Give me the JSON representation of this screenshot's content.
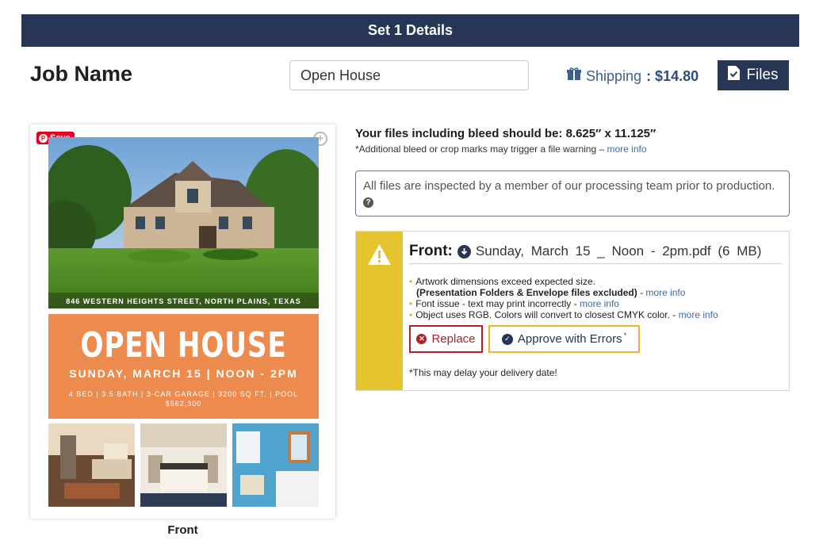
{
  "header": {
    "title": "Set 1 Details"
  },
  "job": {
    "label": "Job Name",
    "value": "Open House"
  },
  "shipping": {
    "label": "Shipping",
    "amount": ": $14.80"
  },
  "files_button": {
    "label": "Files"
  },
  "flyer": {
    "pin_save_label": "Save",
    "address": "846 WESTERN HEIGHTS STREET, NORTH PLAINS, TEXAS",
    "headline": "OPEN HOUSE",
    "date_time": "SUNDAY, MARCH 15  | NOON - 2PM",
    "details": "4 BED | 3.5 BATH | 3-CAR GARAGE | 3200 SQ FT. | POOL",
    "price": "$562,300",
    "caption": "Front"
  },
  "bleed": {
    "title": "Your files including bleed should be: 8.625″ x 11.125″",
    "note": "*Additional bleed or crop marks may trigger a file warning –",
    "more_info": "more info"
  },
  "inspection": {
    "text": "All files are inspected by a member of our processing team prior to production."
  },
  "file_warning": {
    "side_label": "Front:",
    "filename": "Sunday, March 15 _ Noon - 2pm.pdf (6 MB)",
    "issues": [
      {
        "text": "Artwork dimensions exceed expected size.",
        "subtext": "(Presentation Folders & Envelope files excluded)",
        "link": "more info"
      },
      {
        "text": "Font issue - text may print incorrectly -",
        "link": "more info"
      },
      {
        "text": "Object uses RGB. Colors will convert to closest CMYK color. -",
        "link": "more info"
      }
    ],
    "replace_label": "Replace",
    "approve_label": "Approve with Errors",
    "approve_mark": "*",
    "delay_note": "*This may delay your delivery date!"
  },
  "colors": {
    "navy": "#263654",
    "warning_yellow": "#e4c42f",
    "error_red": "#b3202b",
    "accent_orange": "#ed8a4e",
    "link_blue": "#3e6aa8"
  }
}
